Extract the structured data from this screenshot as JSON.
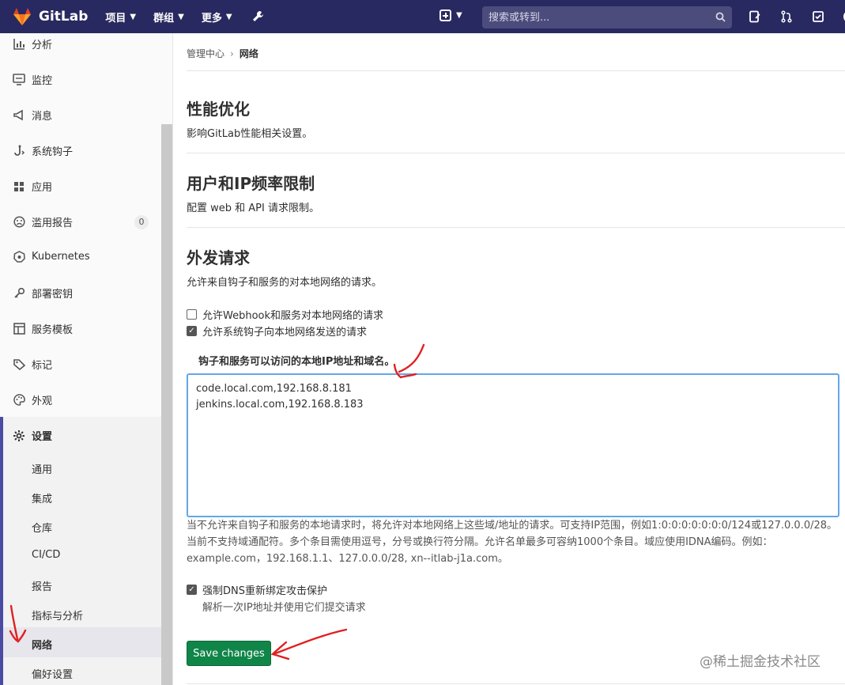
{
  "navbar": {
    "brand": "GitLab",
    "menu": [
      {
        "label": "项目"
      },
      {
        "label": "群组"
      },
      {
        "label": "更多"
      }
    ],
    "search_placeholder": "搜索或转到..."
  },
  "sidebar": {
    "items": [
      {
        "label": "分析",
        "icon": "chart-icon"
      },
      {
        "label": "监控",
        "icon": "monitor-icon"
      },
      {
        "label": "消息",
        "icon": "megaphone-icon"
      },
      {
        "label": "系统钩子",
        "icon": "hook-icon"
      },
      {
        "label": "应用",
        "icon": "apps-icon"
      },
      {
        "label": "滥用报告",
        "icon": "sad-face-icon",
        "badge": "0"
      },
      {
        "label": "Kubernetes",
        "icon": "kubernetes-icon"
      },
      {
        "label": "部署密钥",
        "icon": "key-icon"
      },
      {
        "label": "服务模板",
        "icon": "template-icon"
      },
      {
        "label": "标记",
        "icon": "label-icon"
      },
      {
        "label": "外观",
        "icon": "palette-icon"
      }
    ],
    "settings": {
      "label": "设置",
      "subitems": [
        "通用",
        "集成",
        "仓库",
        "CI/CD",
        "报告",
        "指标与分析",
        "网络",
        "偏好设置"
      ]
    }
  },
  "breadcrumb": {
    "parent": "管理中心",
    "current": "网络"
  },
  "sections": [
    {
      "title": "性能优化",
      "desc": "影响GitLab性能相关设置。"
    },
    {
      "title": "用户和IP频率限制",
      "desc": "配置 web 和 API 请求限制。"
    },
    {
      "title": "外发请求",
      "desc": "允许来自钩子和服务的对本地网络的请求。"
    }
  ],
  "outbound": {
    "checkbox_webhooks": {
      "label": "允许Webhook和服务对本地网络的请求",
      "checked": false
    },
    "checkbox_system_hooks": {
      "label": "允许系统钩子向本地网络发送的请求",
      "checked": true
    },
    "whitelist_label": "钩子和服务可以访问的本地IP地址和域名。",
    "whitelist_value": "code.local.com,192.168.8.181\njenkins.local.com,192.168.8.183",
    "whitelist_help": "当不允许来自钩子和服务的本地请求时，将允许对本地网络上这些域/地址的请求。可支持IP范围，例如1:0:0:0:0:0:0:0/124或127.0.0.0/28。当前不支持域通配符。多个条目需使用逗号，分号或换行符分隔。允许名单最多可容纳1000个条目。域应使用IDNA编码。例如：example.com，192.168.1.1、127.0.0.0/28, xn--itlab-j1a.com。",
    "dns_rebind": {
      "label": "强制DNS重新绑定攻击保护",
      "checked": true,
      "help": "解析一次IP地址并使用它们提交请求"
    },
    "save_label": "Save changes"
  },
  "watermark": "@稀土掘金技术社区",
  "colors": {
    "navbar": "#292961",
    "accent": "#4b4ba3",
    "save_button": "#108548",
    "annotation": "#e02020"
  }
}
